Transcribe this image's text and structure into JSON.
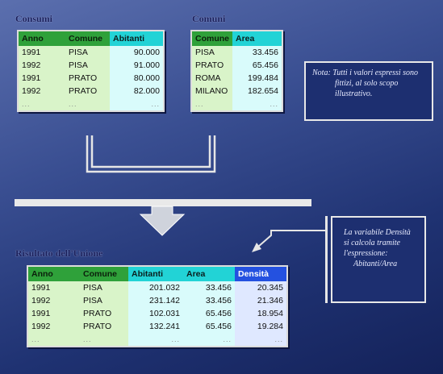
{
  "consumo": {
    "title": "Consumi",
    "headers": [
      "Anno",
      "Comune",
      "Abitanti"
    ],
    "rows": [
      [
        "1991",
        "PISA",
        "90.000"
      ],
      [
        "1992",
        "PISA",
        "91.000"
      ],
      [
        "1991",
        "PRATO",
        "80.000"
      ],
      [
        "1992",
        "PRATO",
        "82.000"
      ]
    ],
    "ellipsis": [
      "...",
      "...",
      "..."
    ]
  },
  "comuni": {
    "title": "Comuni",
    "headers": [
      "Comune",
      "Area"
    ],
    "rows": [
      [
        "PISA",
        "33.456"
      ],
      [
        "PRATO",
        "65.456"
      ],
      [
        "ROMA",
        "199.484"
      ],
      [
        "MILANO",
        "182.654"
      ]
    ],
    "ellipsis": [
      "...",
      "..."
    ]
  },
  "risultato": {
    "title": "Risultato dell'Unione",
    "headers": [
      "Anno",
      "Comune",
      "Abitanti",
      "Area",
      "Densità"
    ],
    "rows": [
      [
        "1991",
        "PISA",
        "201.032",
        "33.456",
        "20.345"
      ],
      [
        "1992",
        "PISA",
        "231.142",
        "33.456",
        "21.346"
      ],
      [
        "1991",
        "PRATO",
        "102.031",
        "65.456",
        "18.954"
      ],
      [
        "1992",
        "PRATO",
        "132.241",
        "65.456",
        "19.284"
      ]
    ],
    "ellipsis": [
      "...",
      "...",
      "...",
      "...",
      "..."
    ]
  },
  "note_top": {
    "lines": [
      "Nota: Tutti i valori espressi sono",
      "fittizi, al solo scopo",
      "illustrativo."
    ]
  },
  "note_bottom": {
    "lines": [
      "La variabile Densità",
      "si calcola tramite",
      "l'espressione:",
      "Abitanti/Area"
    ]
  },
  "colors": {
    "green_header": "#2fa13a",
    "cyan_header": "#22d3d6",
    "blue_header": "#2451e0",
    "background": "#1f3272"
  }
}
